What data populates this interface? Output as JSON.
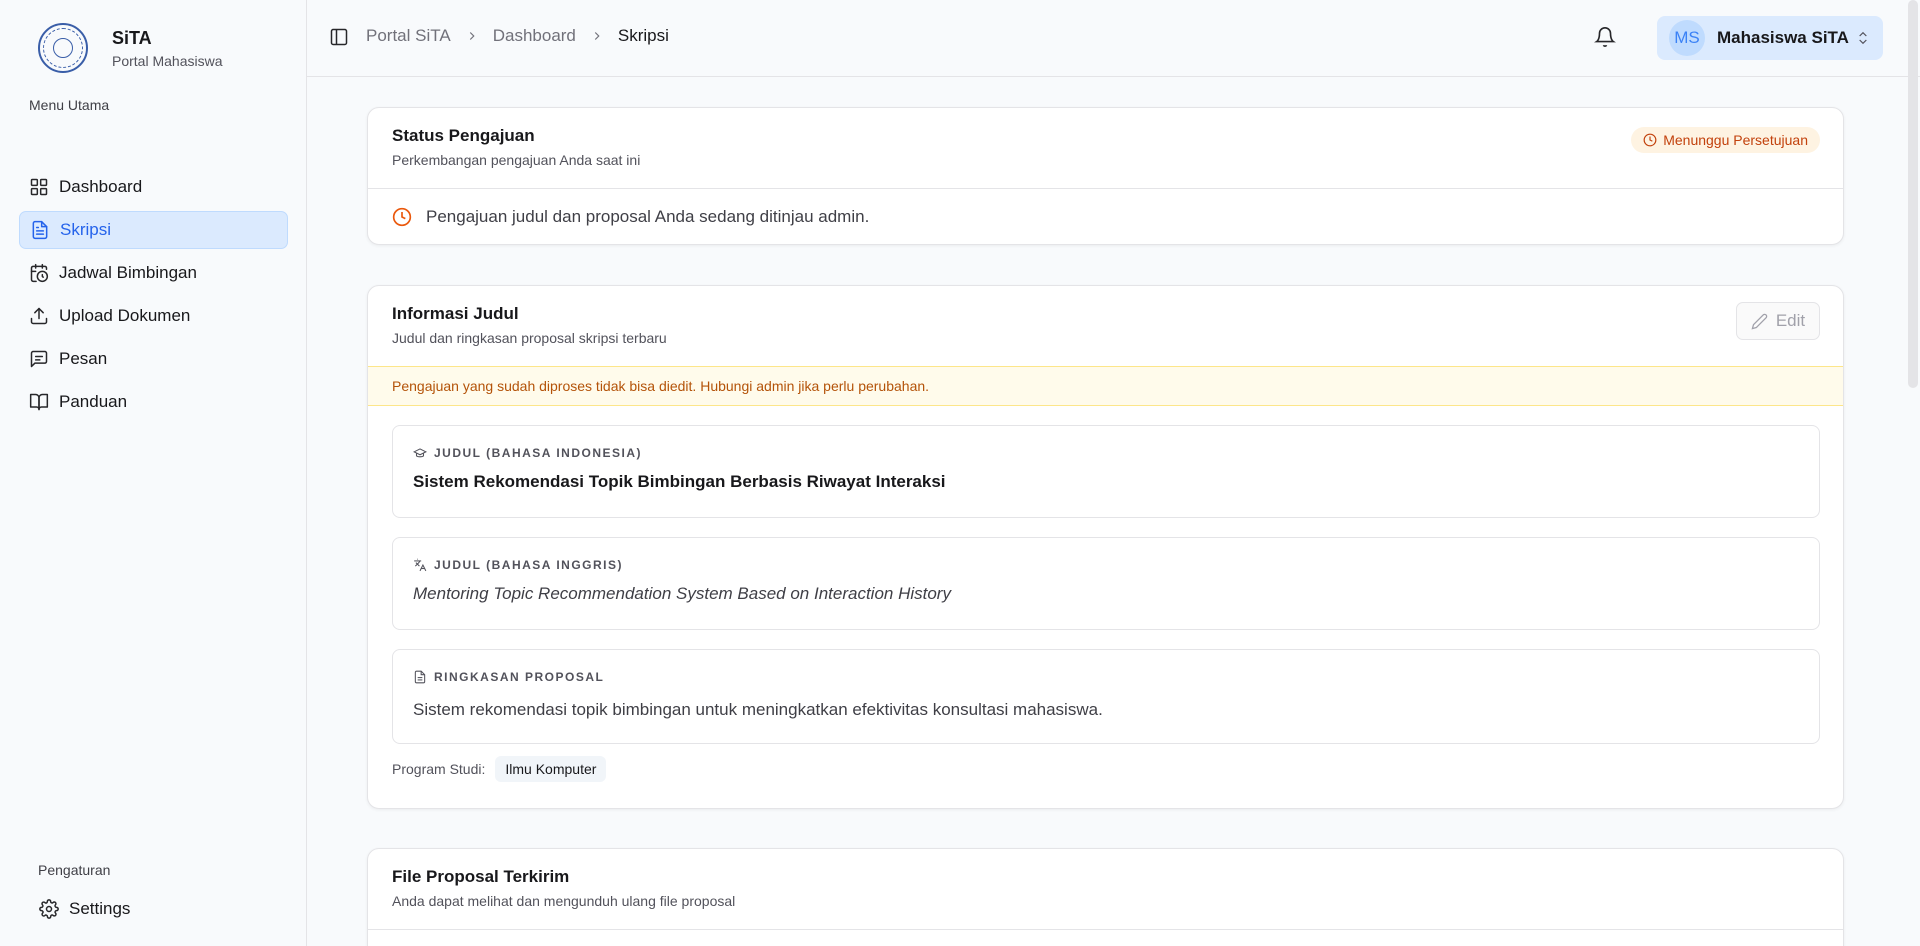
{
  "brand": {
    "title": "SiTA",
    "subtitle": "Portal Mahasiswa"
  },
  "sidebar": {
    "menu_label": "Menu Utama",
    "items": [
      {
        "label": "Dashboard",
        "icon": "dashboard-icon"
      },
      {
        "label": "Skripsi",
        "icon": "file-text-icon",
        "active": true
      },
      {
        "label": "Jadwal Bimbingan",
        "icon": "calendar-clock-icon"
      },
      {
        "label": "Upload Dokumen",
        "icon": "upload-icon"
      },
      {
        "label": "Pesan",
        "icon": "message-icon"
      },
      {
        "label": "Panduan",
        "icon": "book-open-icon"
      }
    ],
    "settings_label": "Pengaturan",
    "settings_item": "Settings"
  },
  "header": {
    "breadcrumb": [
      "Portal SiTA",
      "Dashboard",
      "Skripsi"
    ],
    "user": {
      "initials": "MS",
      "name": "Mahasiswa SiTA"
    }
  },
  "status_card": {
    "title": "Status Pengajuan",
    "subtitle": "Perkembangan pengajuan Anda saat ini",
    "badge": "Menunggu Persetujuan",
    "message": "Pengajuan judul dan proposal Anda sedang ditinjau admin."
  },
  "info_card": {
    "title": "Informasi Judul",
    "subtitle": "Judul dan ringkasan proposal skripsi terbaru",
    "edit_label": "Edit",
    "warning": "Pengajuan yang sudah diproses tidak bisa diedit. Hubungi admin jika perlu perubahan.",
    "judul_id_label": "JUDUL (BAHASA INDONESIA)",
    "judul_id": "Sistem Rekomendasi Topik Bimbingan Berbasis Riwayat Interaksi",
    "judul_en_label": "JUDUL (BAHASA INGGRIS)",
    "judul_en": "Mentoring Topic Recommendation System Based on Interaction History",
    "ringkasan_label": "RINGKASAN PROPOSAL",
    "ringkasan": "Sistem rekomendasi topik bimbingan untuk meningkatkan efektivitas konsultasi mahasiswa.",
    "prodi_label": "Program Studi:",
    "prodi": "Ilmu Komputer"
  },
  "file_card": {
    "title": "File Proposal Terkirim",
    "subtitle": "Anda dapat melihat dan mengunduh ulang file proposal"
  },
  "colors": {
    "accent": "#2563eb",
    "warning": "#c2410c",
    "active_bg": "#dbeafe"
  }
}
